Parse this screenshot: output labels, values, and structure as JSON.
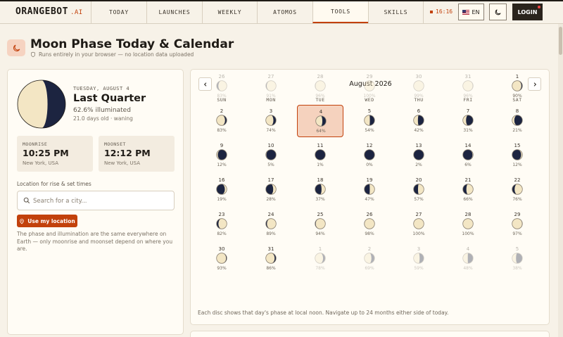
{
  "nav": {
    "logo": "ORANGEBOT",
    "logo_suffix": ".AI",
    "tabs": [
      "TODAY",
      "LAUNCHES",
      "WEEKLY",
      "ATOMOS",
      "TOOLS",
      "SKILLS"
    ],
    "active_tab": "TOOLS",
    "clock": "16:16",
    "lang": "EN",
    "login": "LOGIN",
    "accent": "#c2410c"
  },
  "header": {
    "title": "Moon Phase Today & Calendar",
    "subtitle": "Runs entirely in your browser — no location data uploaded"
  },
  "today": {
    "date": "TUESDAY, AUGUST 4",
    "phase": "Last Quarter",
    "illumination": "62.6% illuminated",
    "age": "21.0 days old · waning",
    "illum_fraction": 0.626,
    "waxing": false
  },
  "moonrise": {
    "label": "MOONRISE",
    "time": "10:25 PM",
    "location": "New York, USA"
  },
  "moonset": {
    "label": "MOONSET",
    "time": "12:12 PM",
    "location": "New York, USA"
  },
  "location": {
    "label": "Location for rise & set times",
    "placeholder": "Search for a city...",
    "button": "Use my location"
  },
  "note": "The phase and illumination are the same everywhere on Earth — only moonrise and moonset depend on where you are.",
  "calendar": {
    "month": "August 2026",
    "weekdays": [
      "SUN",
      "MON",
      "TUE",
      "WED",
      "THU",
      "FRI",
      "SAT"
    ],
    "today_day": 4,
    "footnote": "Each disc shows that day's phase at local noon. Navigate up to 24 months either side of today.",
    "days": [
      {
        "d": "26",
        "p": "83%",
        "f": 0.83,
        "w": true,
        "out": true
      },
      {
        "d": "27",
        "p": "91%",
        "f": 0.91,
        "w": true,
        "out": true
      },
      {
        "d": "28",
        "p": "96%",
        "f": 0.96,
        "w": true,
        "out": true
      },
      {
        "d": "29",
        "p": "100%",
        "f": 1.0,
        "w": true,
        "out": true
      },
      {
        "d": "30",
        "p": "99%",
        "f": 0.99,
        "w": false,
        "out": true
      },
      {
        "d": "31",
        "p": "96%",
        "f": 0.96,
        "w": false,
        "out": true
      },
      {
        "d": "1",
        "p": "90%",
        "f": 0.9,
        "w": false
      },
      {
        "d": "2",
        "p": "83%",
        "f": 0.83,
        "w": false
      },
      {
        "d": "3",
        "p": "74%",
        "f": 0.74,
        "w": false
      },
      {
        "d": "4",
        "p": "64%",
        "f": 0.64,
        "w": false
      },
      {
        "d": "5",
        "p": "54%",
        "f": 0.54,
        "w": false
      },
      {
        "d": "6",
        "p": "42%",
        "f": 0.42,
        "w": false
      },
      {
        "d": "7",
        "p": "31%",
        "f": 0.31,
        "w": false
      },
      {
        "d": "8",
        "p": "21%",
        "f": 0.21,
        "w": false
      },
      {
        "d": "9",
        "p": "12%",
        "f": 0.12,
        "w": false
      },
      {
        "d": "10",
        "p": "5%",
        "f": 0.05,
        "w": false
      },
      {
        "d": "11",
        "p": "1%",
        "f": 0.01,
        "w": false
      },
      {
        "d": "12",
        "p": "0%",
        "f": 0.0,
        "w": true
      },
      {
        "d": "13",
        "p": "2%",
        "f": 0.02,
        "w": true
      },
      {
        "d": "14",
        "p": "6%",
        "f": 0.06,
        "w": true
      },
      {
        "d": "15",
        "p": "12%",
        "f": 0.12,
        "w": true
      },
      {
        "d": "16",
        "p": "19%",
        "f": 0.19,
        "w": true
      },
      {
        "d": "17",
        "p": "28%",
        "f": 0.28,
        "w": true
      },
      {
        "d": "18",
        "p": "37%",
        "f": 0.37,
        "w": true
      },
      {
        "d": "19",
        "p": "47%",
        "f": 0.47,
        "w": true
      },
      {
        "d": "20",
        "p": "57%",
        "f": 0.57,
        "w": true
      },
      {
        "d": "21",
        "p": "66%",
        "f": 0.66,
        "w": true
      },
      {
        "d": "22",
        "p": "76%",
        "f": 0.76,
        "w": true
      },
      {
        "d": "23",
        "p": "82%",
        "f": 0.82,
        "w": true
      },
      {
        "d": "24",
        "p": "89%",
        "f": 0.89,
        "w": true
      },
      {
        "d": "25",
        "p": "94%",
        "f": 0.94,
        "w": true
      },
      {
        "d": "26",
        "p": "98%",
        "f": 0.98,
        "w": true
      },
      {
        "d": "27",
        "p": "100%",
        "f": 1.0,
        "w": true
      },
      {
        "d": "28",
        "p": "100%",
        "f": 1.0,
        "w": false
      },
      {
        "d": "29",
        "p": "97%",
        "f": 0.97,
        "w": false
      },
      {
        "d": "30",
        "p": "93%",
        "f": 0.93,
        "w": false
      },
      {
        "d": "31",
        "p": "86%",
        "f": 0.86,
        "w": false
      },
      {
        "d": "1",
        "p": "78%",
        "f": 0.78,
        "w": false,
        "out": true
      },
      {
        "d": "2",
        "p": "69%",
        "f": 0.69,
        "w": false,
        "out": true
      },
      {
        "d": "3",
        "p": "59%",
        "f": 0.59,
        "w": false,
        "out": true
      },
      {
        "d": "4",
        "p": "48%",
        "f": 0.48,
        "w": false,
        "out": true
      },
      {
        "d": "5",
        "p": "38%",
        "f": 0.38,
        "w": false,
        "out": true
      }
    ]
  },
  "colors": {
    "moon_light": "#f3e6c4",
    "moon_dark": "#1c2440",
    "today_bg": "#f5d2be"
  }
}
